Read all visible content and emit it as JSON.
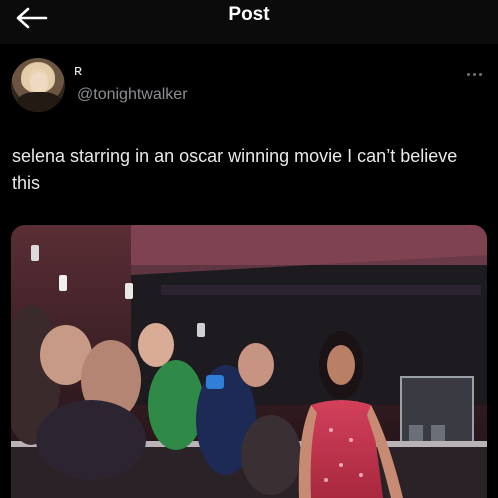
{
  "header": {
    "title": "Post",
    "back_icon": "arrow-left-icon"
  },
  "author": {
    "name_mark": "ʀ",
    "handle": "@tonightwalker",
    "avatar": "profile-photo"
  },
  "post": {
    "text": "selena starring in an oscar winning movie I can’t believe this",
    "more_icon": "more-horizontal-icon"
  },
  "media": {
    "type": "video-still",
    "scene": "performer in red dress walking past crowd holding up phones"
  },
  "colors": {
    "background": "#000000",
    "text": "#e7e9ea",
    "secondary": "#8b8e92"
  }
}
